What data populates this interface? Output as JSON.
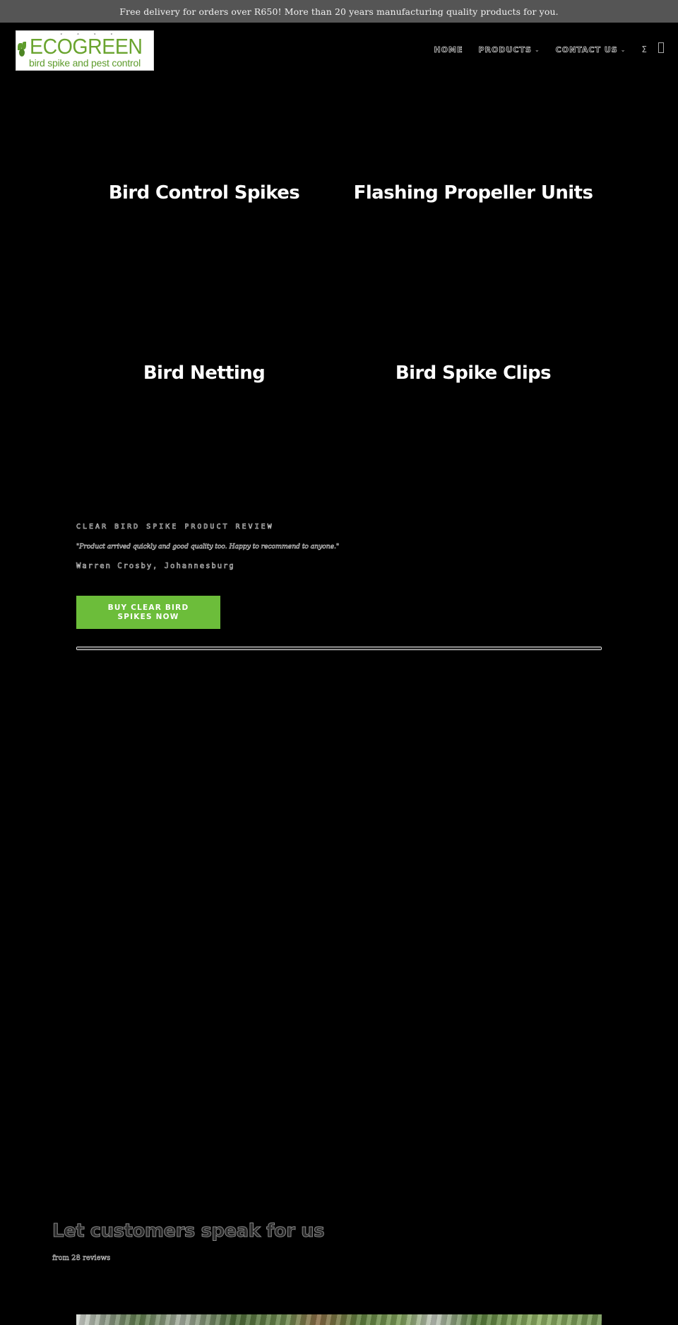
{
  "announcement": {
    "text": "Free delivery for orders over R650! More than 20 years manufacturing quality products for you."
  },
  "header": {
    "logo": {
      "wordmark": "ECOGREEN",
      "tagline": "bird spike and pest control",
      "brand_color": "#6aa42f"
    },
    "nav": {
      "items": [
        {
          "label": "HOME",
          "has_dropdown": false
        },
        {
          "label": "PRODUCTS",
          "has_dropdown": true
        },
        {
          "label": "CONTACT US",
          "has_dropdown": true
        }
      ],
      "icons": [
        {
          "name": "account-icon",
          "glyph": "Σ"
        },
        {
          "name": "cart-icon",
          "glyph": ""
        }
      ]
    }
  },
  "categories": [
    {
      "label": "Bird Control Spikes"
    },
    {
      "label": "Flashing Propeller Units"
    },
    {
      "label": "Bird Netting"
    },
    {
      "label": "Bird Spike Clips"
    }
  ],
  "featured_review": {
    "heading": "CLEAR BIRD SPIKE PRODUCT REVIEW",
    "quote": "\"Product arrived quickly and good quality too. Happy to recommend to anyone.\"",
    "author": "Warren Crosby, Johannesburg",
    "cta_label": "BUY CLEAR BIRD SPIKES NOW",
    "cta_color": "#6cbd3a",
    "slider_progress": 1.0
  },
  "reviews_section": {
    "title": "Let customers speak for us",
    "count_text": "from 28 reviews"
  }
}
